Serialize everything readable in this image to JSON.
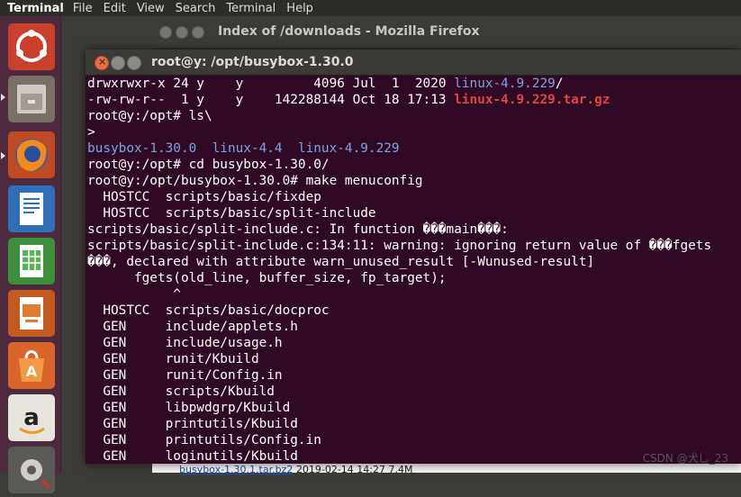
{
  "topbar": {
    "app": "Terminal",
    "menus": [
      "File",
      "Edit",
      "View",
      "Search",
      "Terminal",
      "Help"
    ]
  },
  "launcher": {
    "items": [
      "ubuntu-dash",
      "files",
      "firefox",
      "writer",
      "calc",
      "impress",
      "software-center",
      "amazon",
      "system-settings"
    ]
  },
  "firefox": {
    "title": "Index of /downloads - Mozilla Firefox",
    "bottom_link": "busybox-1.30.1.tar.bz2",
    "bottom_meta": "2019-02-14 14:27  7.4M"
  },
  "terminal": {
    "title": "root@y: /opt/busybox-1.30.0",
    "lines": [
      [
        {
          "t": "drwxrwxr-x 24 y    y         4096 Jul  1  2020 "
        },
        {
          "t": "linux-4.9.229",
          "c": "blue"
        },
        {
          "t": "/"
        }
      ],
      [
        {
          "t": "-rw-rw-r--  1 y    y    142288144 Oct 18 17:13 "
        },
        {
          "t": "linux-4.9.229.tar.gz",
          "c": "red"
        }
      ],
      [
        {
          "t": "root@y:/opt# ls\\"
        }
      ],
      [
        {
          "t": ">"
        }
      ],
      [
        {
          "t": "busybox-1.30.0",
          "c": "blue"
        },
        {
          "t": "  "
        },
        {
          "t": "linux-4.4",
          "c": "blue"
        },
        {
          "t": "  "
        },
        {
          "t": "linux-4.9.229",
          "c": "blue"
        }
      ],
      [
        {
          "t": "root@y:/opt# cd busybox-1.30.0/"
        }
      ],
      [
        {
          "t": "root@y:/opt/busybox-1.30.0# make menuconfig"
        }
      ],
      [
        {
          "t": "  HOSTCC  scripts/basic/fixdep"
        }
      ],
      [
        {
          "t": "  HOSTCC  scripts/basic/split-include"
        }
      ],
      [
        {
          "t": "scripts/basic/split-include.c: In function ���main���:"
        }
      ],
      [
        {
          "t": "scripts/basic/split-include.c:134:11: warning: ignoring return value of ���fgets"
        }
      ],
      [
        {
          "t": "���, declared with attribute warn_unused_result [-Wunused-result]"
        }
      ],
      [
        {
          "t": "      fgets(old_line, buffer_size, fp_target);"
        }
      ],
      [
        {
          "t": "           ^"
        }
      ],
      [
        {
          "t": "  HOSTCC  scripts/basic/docproc"
        }
      ],
      [
        {
          "t": "  GEN     include/applets.h"
        }
      ],
      [
        {
          "t": "  GEN     include/usage.h"
        }
      ],
      [
        {
          "t": "  GEN     runit/Kbuild"
        }
      ],
      [
        {
          "t": "  GEN     runit/Config.in"
        }
      ],
      [
        {
          "t": "  GEN     scripts/Kbuild"
        }
      ],
      [
        {
          "t": "  GEN     libpwdgrp/Kbuild"
        }
      ],
      [
        {
          "t": "  GEN     printutils/Kbuild"
        }
      ],
      [
        {
          "t": "  GEN     printutils/Config.in"
        }
      ],
      [
        {
          "t": "  GEN     loginutils/Kbuild"
        }
      ]
    ]
  },
  "watermark": "CSDN @犬乚_23"
}
